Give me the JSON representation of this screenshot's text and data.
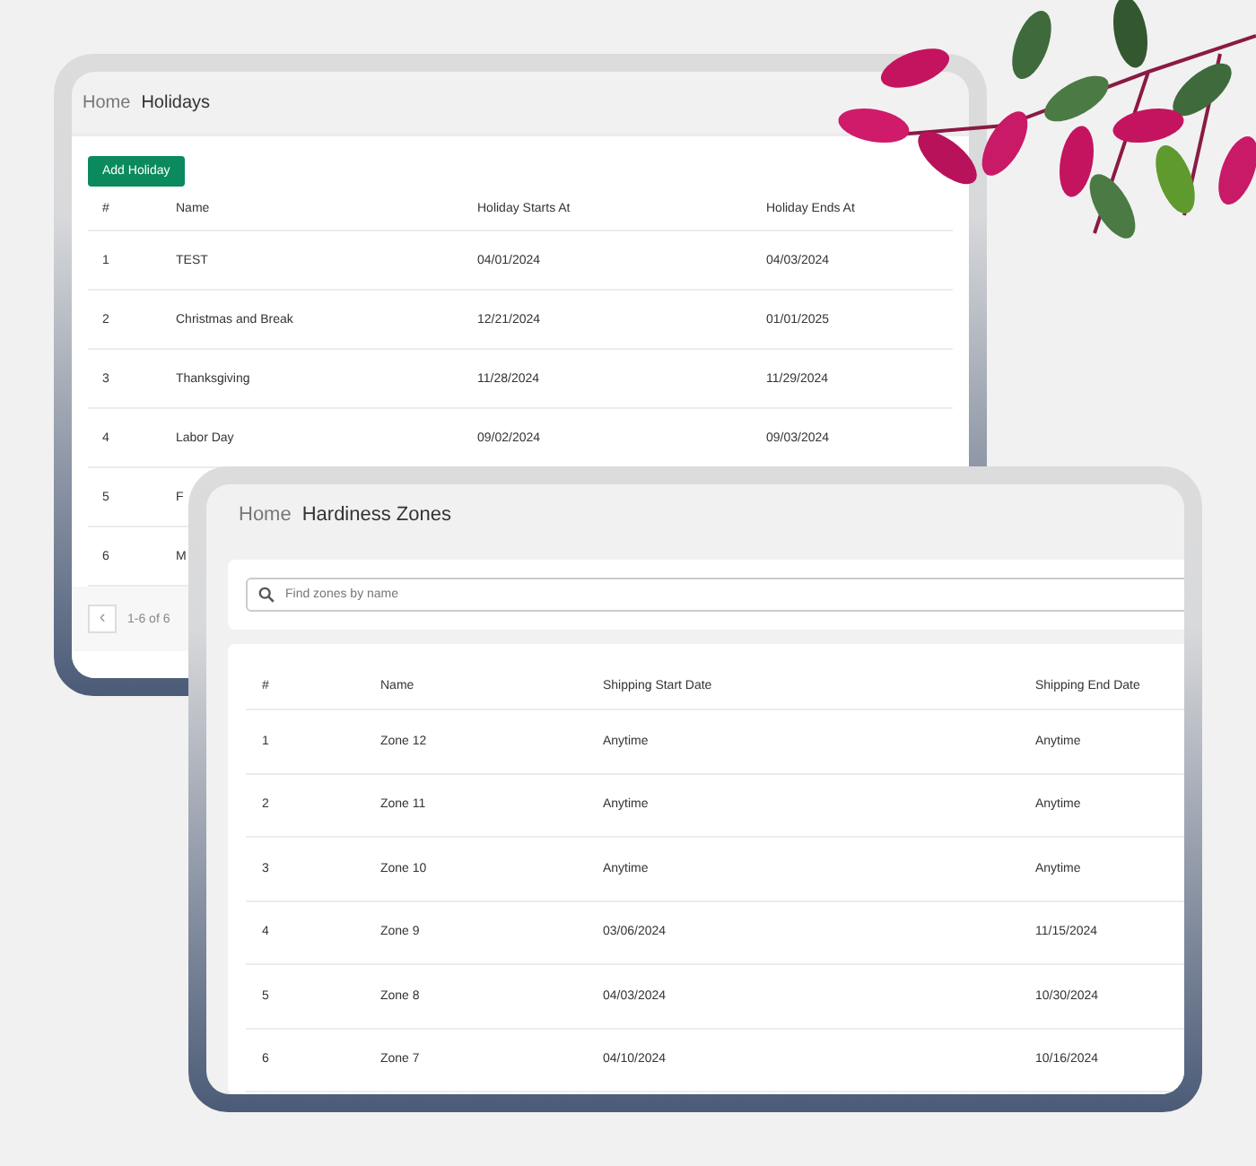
{
  "holidays_window": {
    "breadcrumb": {
      "home": "Home",
      "current": "Holidays"
    },
    "add_button": "Add Holiday",
    "columns": [
      "#",
      "Name",
      "Holiday Starts At",
      "Holiday Ends At"
    ],
    "rows": [
      {
        "number": "1",
        "name": "TEST",
        "starts": "04/01/2024",
        "ends": "04/03/2024"
      },
      {
        "number": "2",
        "name": "Christmas and Break",
        "starts": "12/21/2024",
        "ends": "01/01/2025"
      },
      {
        "number": "3",
        "name": "Thanksgiving",
        "starts": "11/28/2024",
        "ends": "11/29/2024"
      },
      {
        "number": "4",
        "name": "Labor Day",
        "starts": "09/02/2024",
        "ends": "09/03/2024"
      },
      {
        "number": "5",
        "name": "F"
      },
      {
        "number": "6",
        "name": "M"
      }
    ],
    "pagination": {
      "prev": "‹",
      "range": "1-6 of 6"
    }
  },
  "zones_window": {
    "breadcrumb": {
      "home": "Home",
      "current": "Hardiness Zones"
    },
    "search": {
      "placeholder": "Find zones by name"
    },
    "columns": [
      "#",
      "Name",
      "Shipping Start Date",
      "Shipping End Date"
    ],
    "rows": [
      {
        "number": "1",
        "name": "Zone 12",
        "start": "Anytime",
        "end": "Anytime"
      },
      {
        "number": "2",
        "name": "Zone 11",
        "start": "Anytime",
        "end": "Anytime"
      },
      {
        "number": "3",
        "name": "Zone 10",
        "start": "Anytime",
        "end": "Anytime"
      },
      {
        "number": "4",
        "name": "Zone 9",
        "start": "03/06/2024",
        "end": "11/15/2024"
      },
      {
        "number": "5",
        "name": "Zone 8",
        "start": "04/03/2024",
        "end": "10/30/2024"
      },
      {
        "number": "6",
        "name": "Zone 7",
        "start": "04/10/2024",
        "end": "10/16/2024"
      }
    ]
  }
}
